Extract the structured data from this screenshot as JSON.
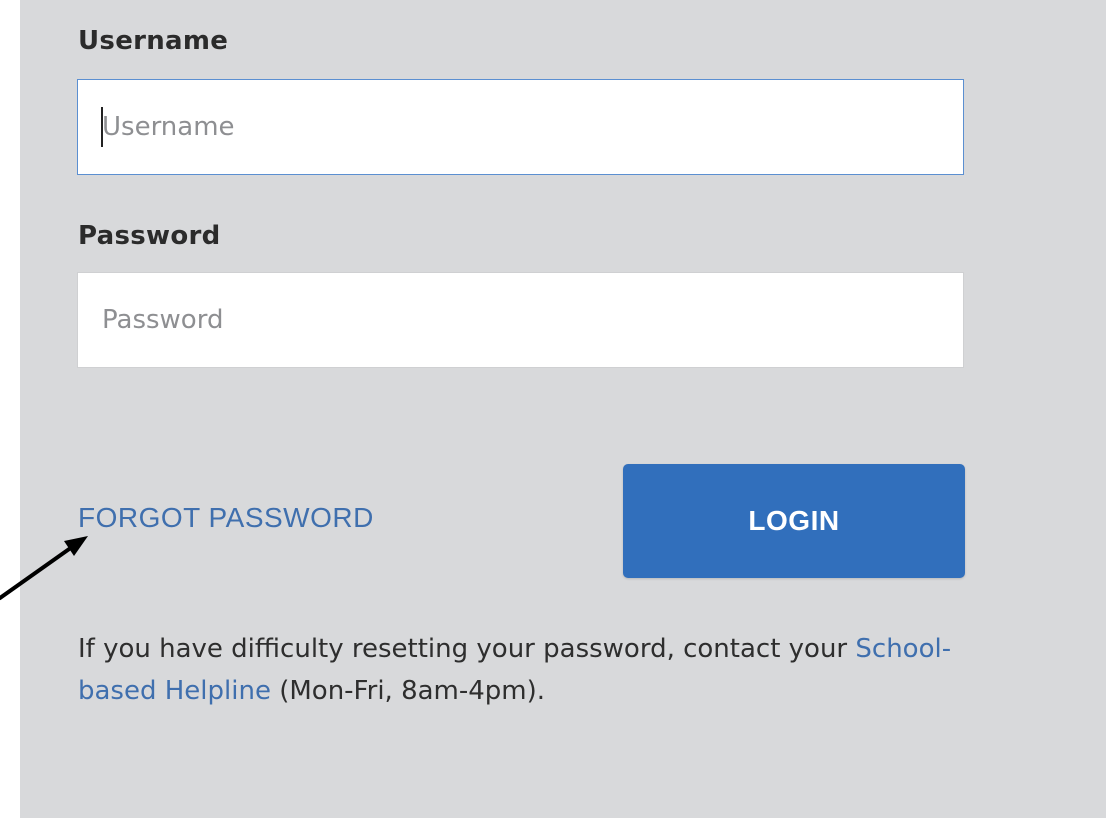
{
  "form": {
    "username_label": "Username",
    "username_placeholder": "Username",
    "password_label": "Password",
    "password_placeholder": "Password",
    "forgot_password_link": "FORGOT PASSWORD",
    "login_button": "LOGIN"
  },
  "help": {
    "text_before": "If you have difficulty resetting your password, contact your ",
    "link_text": "School-based Helpline",
    "text_after": " (Mon-Fri, 8am-4pm)."
  },
  "colors": {
    "panel_background": "#d8d9db",
    "accent_blue": "#316fbc",
    "link_blue": "#3f6fae",
    "focus_border": "#5b8fd1"
  },
  "annotation": {
    "icon": "arrow-icon"
  }
}
